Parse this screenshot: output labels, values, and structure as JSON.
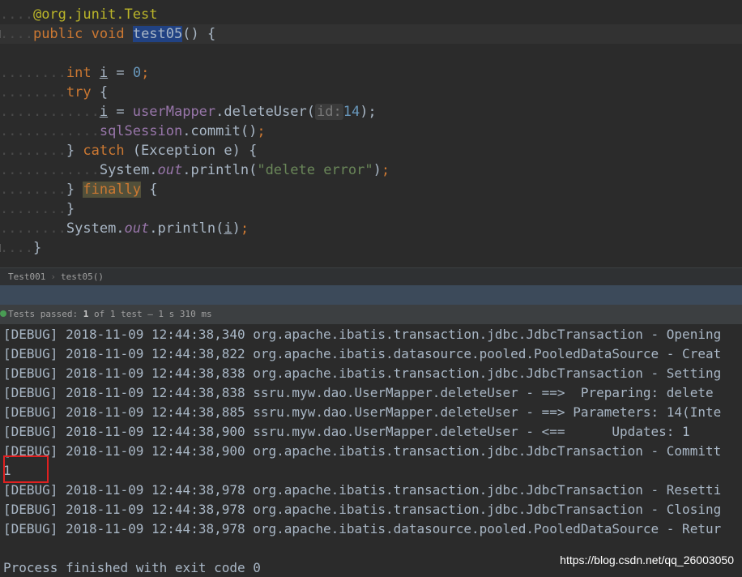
{
  "editor": {
    "line1": {
      "annotation": "@org.junit.Test"
    },
    "line2": {
      "kw_public": "public",
      "kw_void": "void",
      "method": "test05",
      "rest": "() {"
    },
    "line3": {},
    "line4": {
      "kw_int": "int",
      "var": "i",
      "rest": " = ",
      "num": "0",
      "semi": ";"
    },
    "line5": {
      "kw_try": "try",
      "rest": " {"
    },
    "line6": {
      "var": "i",
      "eq": " = ",
      "field": "userMapper",
      "call": ".deleteUser(",
      "hint": "id:",
      "num": "14",
      "close": ");"
    },
    "line7": {
      "field": "sqlSession",
      "call": ".commit()",
      "semi": ";"
    },
    "line8": {
      "brace": "} ",
      "kw_catch": "catch",
      "rest": " (Exception e) {"
    },
    "line9": {
      "cls": "System.",
      "field": "out",
      "call": ".println(",
      "str": "\"delete error\"",
      "close": ")",
      "semi": ";"
    },
    "line10": {
      "brace": "} ",
      "kw_finally": "finally",
      "rest": " {"
    },
    "line11": {
      "brace": "}"
    },
    "line12": {
      "cls": "System.",
      "field": "out",
      "call": ".println(",
      "var": "i",
      "close": ")",
      "semi": ";"
    },
    "line13": {
      "brace": "}"
    }
  },
  "breadcrumb": {
    "class_name": "Test001",
    "method_name": "test05()"
  },
  "tests": {
    "prefix": "Tests passed: ",
    "passed": "1",
    "suffix": " of 1 test – 1 s 310 ms"
  },
  "console": {
    "lines": [
      "[DEBUG] 2018-11-09 12:44:38,340 org.apache.ibatis.transaction.jdbc.JdbcTransaction - Opening",
      "[DEBUG] 2018-11-09 12:44:38,822 org.apache.ibatis.datasource.pooled.PooledDataSource - Creat",
      "[DEBUG] 2018-11-09 12:44:38,838 org.apache.ibatis.transaction.jdbc.JdbcTransaction - Setting",
      "[DEBUG] 2018-11-09 12:44:38,838 ssru.myw.dao.UserMapper.deleteUser - ==>  Preparing: delete",
      "[DEBUG] 2018-11-09 12:44:38,885 ssru.myw.dao.UserMapper.deleteUser - ==> Parameters: 14(Inte",
      "[DEBUG] 2018-11-09 12:44:38,900 ssru.myw.dao.UserMapper.deleteUser - <==      Updates: 1",
      "[DEBUG] 2018-11-09 12:44:38,900 org.apache.ibatis.transaction.jdbc.JdbcTransaction - Committ",
      "1",
      "[DEBUG] 2018-11-09 12:44:38,978 org.apache.ibatis.transaction.jdbc.JdbcTransaction - Resetti",
      "[DEBUG] 2018-11-09 12:44:38,978 org.apache.ibatis.transaction.jdbc.JdbcTransaction - Closing",
      "[DEBUG] 2018-11-09 12:44:38,978 org.apache.ibatis.datasource.pooled.PooledDataSource - Retur",
      "",
      "Process finished with exit code 0"
    ]
  },
  "watermark": "https://blog.csdn.net/qq_26003050"
}
